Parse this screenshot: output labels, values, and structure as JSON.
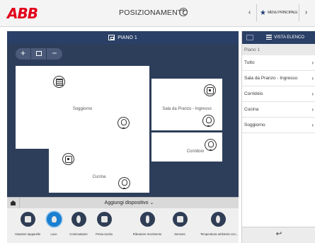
{
  "header": {
    "logo": "ABB",
    "title": "POSIZIONAMENTO",
    "help_icon": "?",
    "nav_back": "‹",
    "nav_main_label": "MENU PRINCIPALE",
    "nav_forward": "›"
  },
  "floor_bar": {
    "label": "PIANO 1"
  },
  "zoom": {
    "plus": "+",
    "minus": "−"
  },
  "rooms": [
    {
      "name": "Soggiorno"
    },
    {
      "name": "Sala da Pranzo - Ingresso"
    },
    {
      "name": "Corridoio"
    },
    {
      "name": "Cucina"
    }
  ],
  "add_device": {
    "label": "Aggiungi dispositivo ⌄"
  },
  "palette": [
    {
      "label": "Attuatore tapparelle",
      "icon": "blind-actuator-icon"
    },
    {
      "label": "Luce",
      "icon": "light-icon"
    },
    {
      "label": "Commutatore",
      "icon": "switch-icon"
    },
    {
      "label": "Presa Uscita",
      "icon": "socket-icon"
    },
    {
      "label": "Rilevatore movimento",
      "icon": "motion-sensor-icon"
    },
    {
      "label": "Sensore",
      "icon": "sensor-icon"
    },
    {
      "label": "Temperatura ambiente con...",
      "icon": "thermostat-icon"
    }
  ],
  "right_panel": {
    "view_label": "VISTA ELENCO",
    "floor_caption": "Piano 1",
    "items": [
      {
        "label": "Tutto"
      },
      {
        "label": "Sala da Pranzo - Ingresso"
      },
      {
        "label": "Corridoio"
      },
      {
        "label": "Cucina"
      },
      {
        "label": "Soggiorno"
      }
    ],
    "chevron": "›",
    "back": "↩"
  },
  "colors": {
    "brand_red": "#e2001a",
    "navy": "#2b4067",
    "canvas": "#2d3e5a",
    "active_blue": "#1b7fd0"
  }
}
